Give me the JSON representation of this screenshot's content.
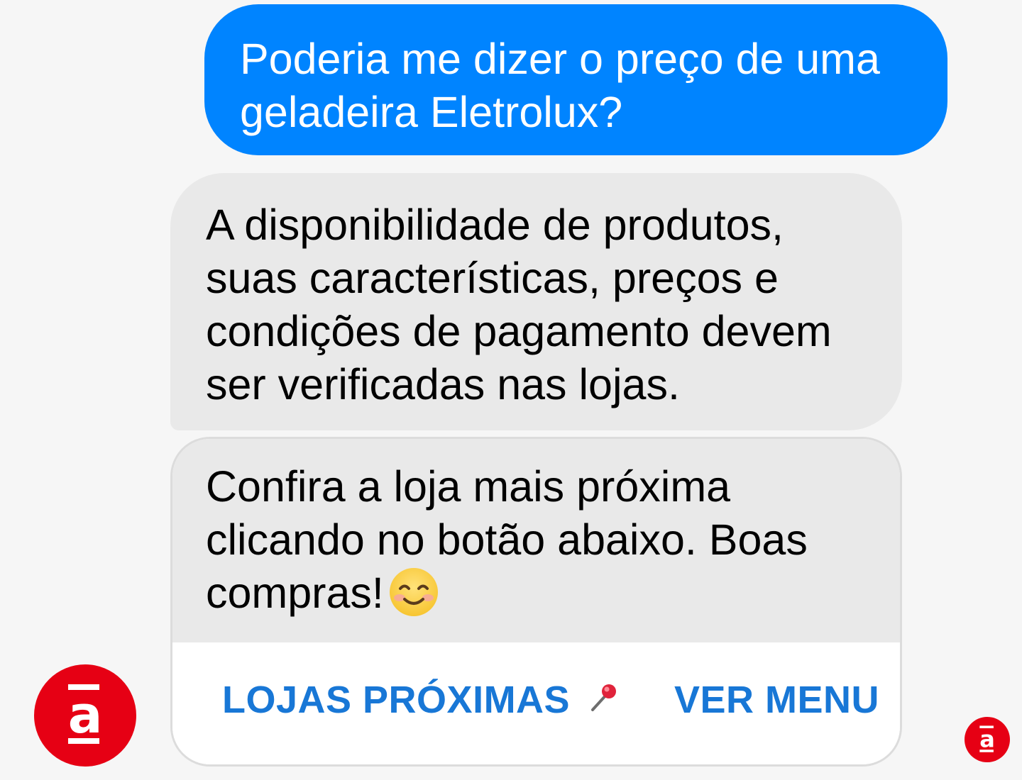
{
  "messages": {
    "user_question": "Poderia me dizer o preço de uma geladeira Eletrolux?",
    "bot_reply_1": "A disponibilidade de produtos, suas características, preços e condições de pagamento devem ser verificadas nas lojas.",
    "bot_reply_2": "Confira a loja mais próxima clicando no botão abaixo. Boas compras!"
  },
  "buttons": {
    "nearby_stores": "LOJAS PRÓXIMAS",
    "view_menu": "VER MENU"
  },
  "icons": {
    "emoji": "smiling-face-icon",
    "pin": "pushpin-icon",
    "avatar": "americanas-logo-icon"
  },
  "colors": {
    "user_bubble": "#0084ff",
    "bot_bubble": "#e9e9e9",
    "button_text": "#1877d6",
    "brand_red": "#e60014",
    "background": "#f6f6f6"
  }
}
